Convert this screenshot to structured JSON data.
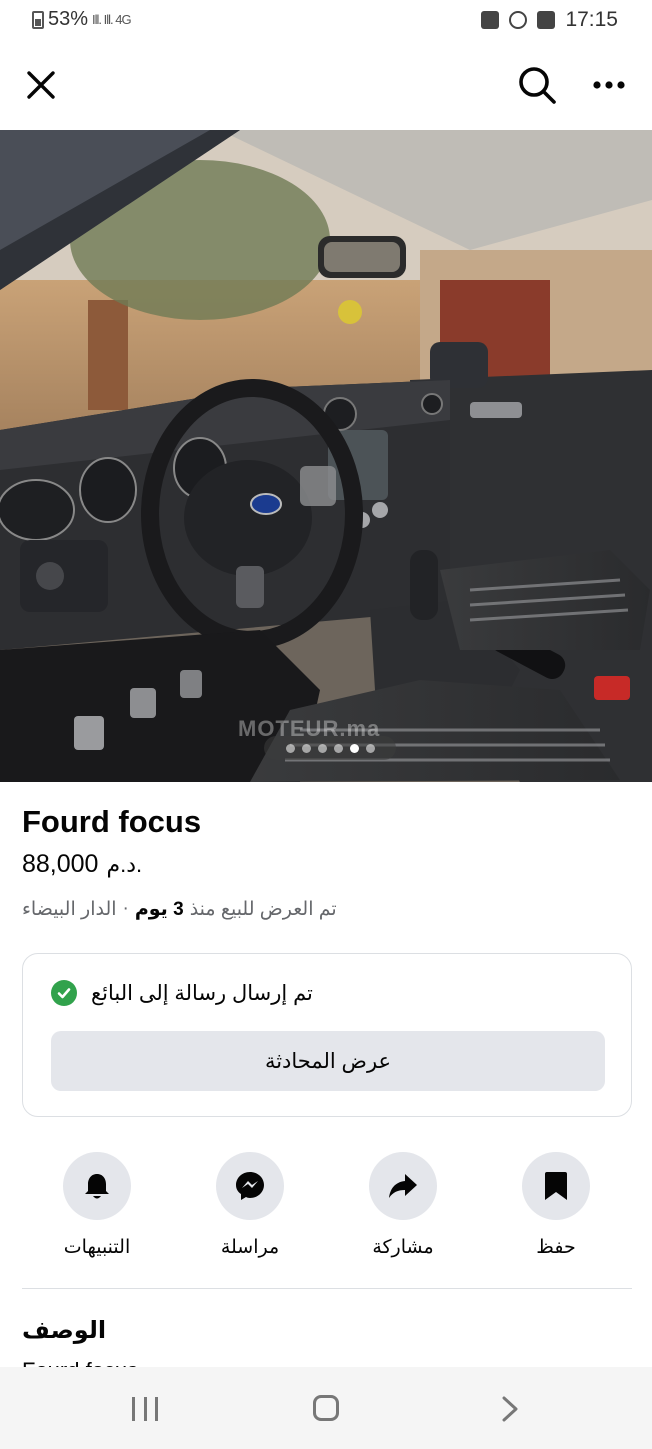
{
  "status_bar": {
    "battery": "53%",
    "signal": "Ill. Ill. 4G",
    "time": "17:15"
  },
  "top_bar": {
    "close_icon": "close-icon",
    "search_icon": "search-icon",
    "more_icon": "more-icon"
  },
  "photo": {
    "description_icon": "car-interior-photo",
    "watermark": "MOTEUR.ma",
    "page_count": 6,
    "active_index": 4
  },
  "listing": {
    "title": "Fourd focus",
    "price": "88,000",
    "currency": "د.م.",
    "meta_prefix": "تم العرض للبيع منذ",
    "meta_days": "3 يوم",
    "meta_sep": "·",
    "meta_location": "الدار البيضاء"
  },
  "message_card": {
    "status_text": "تم إرسال رسالة إلى البائع",
    "view_chat_label": "عرض المحادثة"
  },
  "actions": [
    {
      "label": "التنبيهات",
      "icon": "bell-icon"
    },
    {
      "label": "مراسلة",
      "icon": "messenger-icon"
    },
    {
      "label": "مشاركة",
      "icon": "share-icon"
    },
    {
      "label": "حفظ",
      "icon": "bookmark-icon"
    }
  ],
  "description": {
    "heading": "الوصف",
    "text_peek": "Fourd focus"
  },
  "colors": {
    "accent_green": "#31a24c",
    "button_gray": "#e4e6eb",
    "secondary_text": "#65676b"
  }
}
